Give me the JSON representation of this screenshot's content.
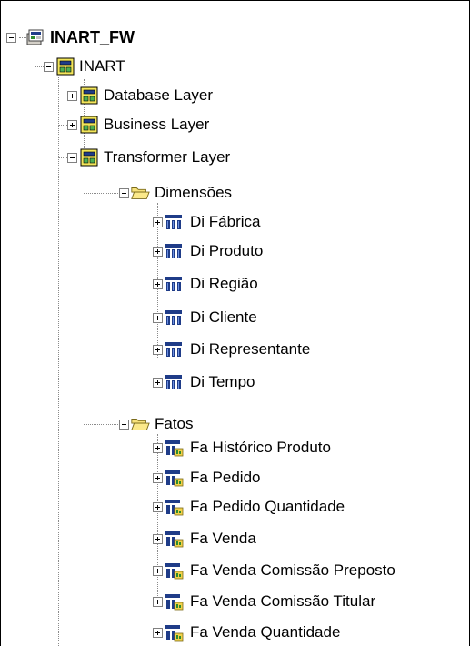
{
  "tree": {
    "root": {
      "label": "INART_FW",
      "icon": "database-model-icon"
    },
    "package": {
      "label": "INART",
      "icon": "package-icon"
    },
    "layers": [
      {
        "label": "Database Layer",
        "icon": "package-icon"
      },
      {
        "label": "Business Layer",
        "icon": "package-icon"
      },
      {
        "label": "Transformer Layer",
        "icon": "package-icon"
      }
    ],
    "folders": {
      "dimensoes": {
        "label": "Dimensões",
        "icon": "folder-open-icon"
      },
      "fatos": {
        "label": "Fatos",
        "icon": "folder-open-icon"
      }
    },
    "dimensions": [
      {
        "label": "Di Fábrica",
        "icon": "dimension-icon"
      },
      {
        "label": "Di Produto",
        "icon": "dimension-icon"
      },
      {
        "label": "Di Região",
        "icon": "dimension-icon"
      },
      {
        "label": "Di Cliente",
        "icon": "dimension-icon"
      },
      {
        "label": "Di Representante",
        "icon": "dimension-icon"
      },
      {
        "label": "Di Tempo",
        "icon": "dimension-icon"
      }
    ],
    "facts": [
      {
        "label": "Fa Histórico Produto",
        "icon": "measure-dimension-icon"
      },
      {
        "label": "Fa Pedido",
        "icon": "measure-dimension-icon"
      },
      {
        "label": "Fa Pedido Quantidade",
        "icon": "measure-dimension-icon"
      },
      {
        "label": "Fa Venda",
        "icon": "measure-dimension-icon"
      },
      {
        "label": "Fa Venda Comissão Preposto",
        "icon": "measure-dimension-icon"
      },
      {
        "label": "Fa Venda Comissão Titular",
        "icon": "measure-dimension-icon"
      },
      {
        "label": "Fa Venda Quantidade",
        "icon": "measure-dimension-icon"
      }
    ]
  }
}
